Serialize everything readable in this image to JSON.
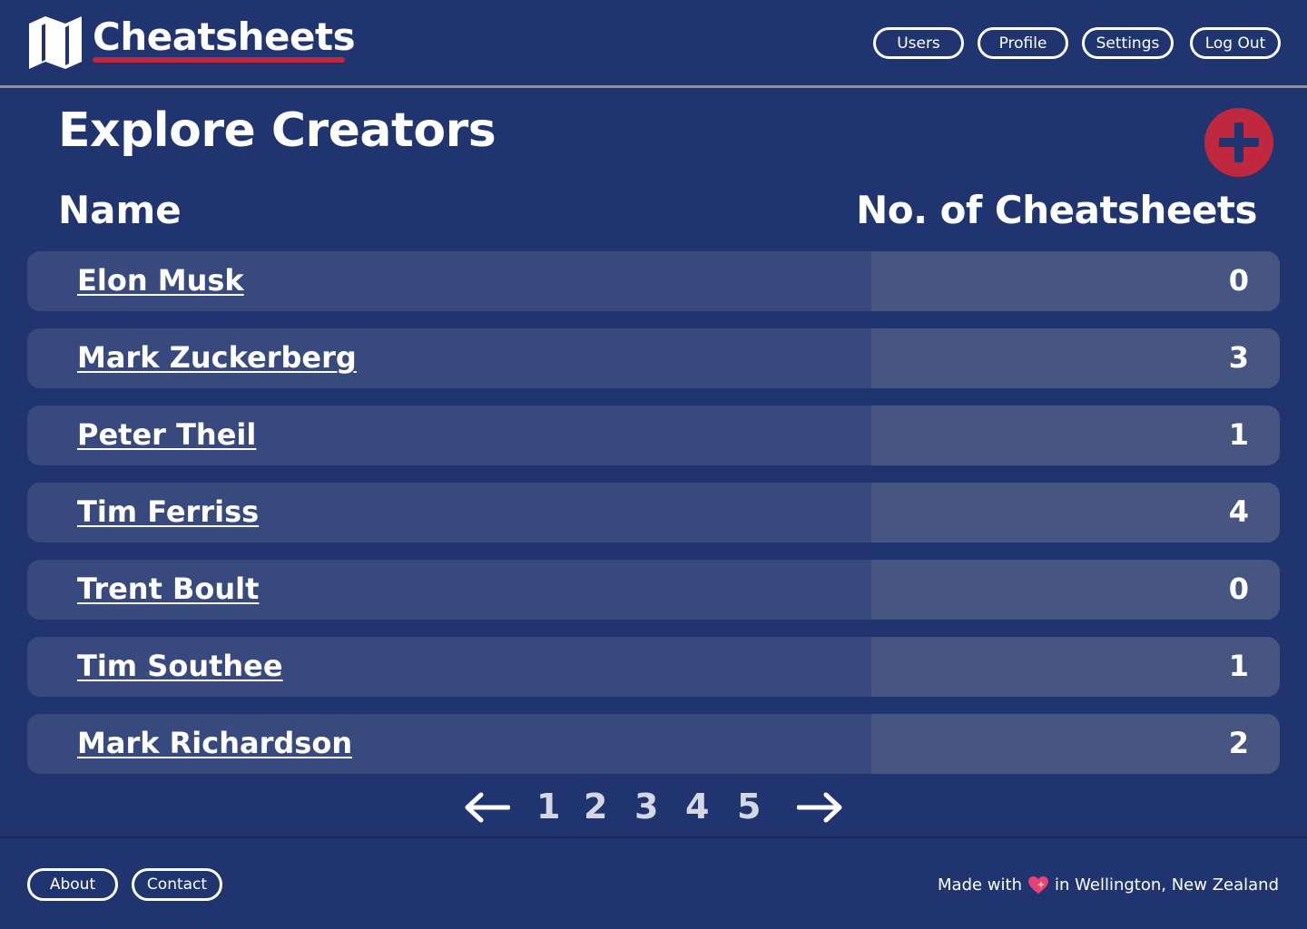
{
  "header": {
    "brand": "Cheatsheets",
    "nav": [
      {
        "label": "Users"
      },
      {
        "label": "Profile"
      },
      {
        "label": "Settings"
      },
      {
        "label": "Log Out"
      }
    ]
  },
  "main": {
    "title": "Explore Creators",
    "columns": {
      "name": "Name",
      "count": "No. of Cheatsheets"
    },
    "rows": [
      {
        "name": "Elon Musk",
        "count": "0"
      },
      {
        "name": "Mark Zuckerberg",
        "count": "3"
      },
      {
        "name": "Peter Theil",
        "count": "1"
      },
      {
        "name": "Tim Ferriss",
        "count": "4"
      },
      {
        "name": "Trent Boult",
        "count": "0"
      },
      {
        "name": "Tim Southee",
        "count": "1"
      },
      {
        "name": "Mark Richardson",
        "count": "2"
      }
    ],
    "pagination": {
      "pages": [
        "1",
        "2",
        "3",
        "4",
        "5"
      ]
    }
  },
  "footer": {
    "about": "About",
    "contact": "Contact",
    "made_with_prefix": "Made with",
    "made_with_suffix": "in Wellington, New Zealand"
  },
  "colors": {
    "background": "#203570",
    "accent": "#c0283f",
    "row": "#384a7d",
    "row_count_cell": "#465681"
  },
  "icons": {
    "logo": "book-map-icon",
    "add": "plus-icon",
    "prev": "arrow-left-icon",
    "next": "arrow-right-icon",
    "heart": "sparkling-heart-icon"
  }
}
